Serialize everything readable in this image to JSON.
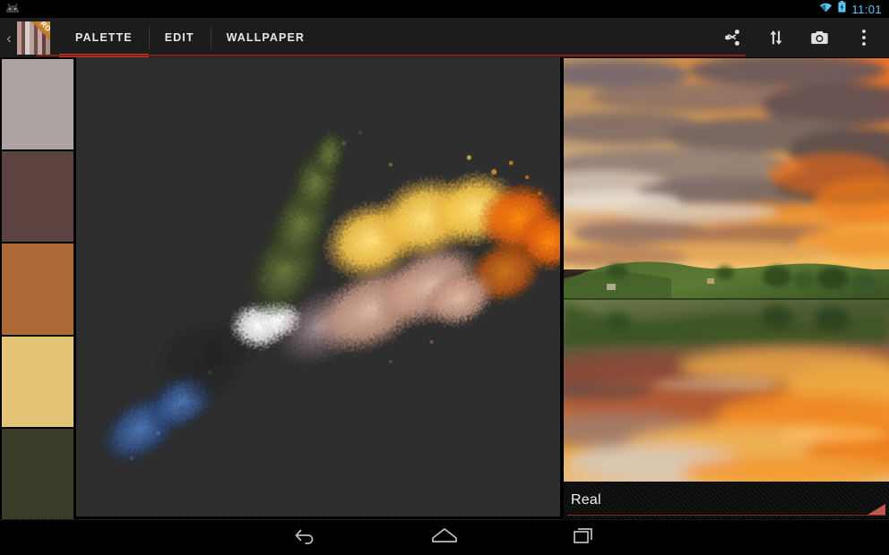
{
  "status_bar": {
    "notification_icon": "android-robot-icon",
    "wifi_icon": "wifi-icon",
    "battery_icon": "battery-charging-icon",
    "time": "11:01",
    "accent_color": "#5BC8F5"
  },
  "action_bar": {
    "up_caret": "‹",
    "app_icon": {
      "name": "palette-app-icon",
      "badge": "PRO",
      "stripe_colors": [
        "#C59A96",
        "#D8CFC8",
        "#B6A39C",
        "#C9A3A6",
        "#AF8E86",
        "#8F6B63"
      ]
    },
    "tabs": [
      {
        "label": "PALETTE",
        "active": true
      },
      {
        "label": "EDIT",
        "active": false
      },
      {
        "label": "WALLPAPER",
        "active": false
      }
    ],
    "active_indicator_color": "#C1392E",
    "actions": [
      {
        "name": "share-icon",
        "label": "Share"
      },
      {
        "name": "sort-swap-icon",
        "label": "Sort"
      },
      {
        "name": "camera-icon",
        "label": "Camera"
      },
      {
        "name": "overflow-menu-icon",
        "label": "More options"
      }
    ]
  },
  "palette": {
    "swatches": [
      {
        "index": 1,
        "color": "#ADA3A3"
      },
      {
        "index": 2,
        "color": "#5C4340"
      },
      {
        "index": 3,
        "color": "#AC6837"
      },
      {
        "index": 4,
        "color": "#E3C375"
      },
      {
        "index": 5,
        "color": "#393D2A"
      }
    ]
  },
  "canvas": {
    "name": "color-cloud-visualization",
    "background_color": "#2E2E2E",
    "description": "3D scatter cloud of image colors"
  },
  "preview": {
    "image_name": "sunset-lake-reflection-photo",
    "caption": "Real",
    "caption_accent_color": "#C0564C"
  },
  "nav_bar": {
    "buttons": [
      {
        "name": "back-icon",
        "label": "Back"
      },
      {
        "name": "home-icon",
        "label": "Home"
      },
      {
        "name": "recents-icon",
        "label": "Recent apps"
      }
    ]
  }
}
